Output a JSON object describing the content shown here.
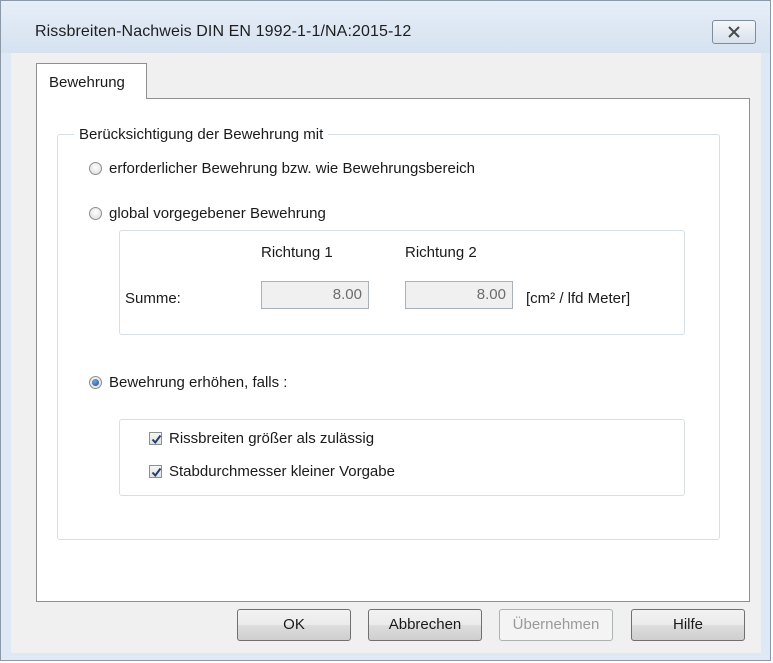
{
  "window": {
    "title": "Rissbreiten-Nachweis DIN EN 1992-1-1/NA:2015-12"
  },
  "tabs": [
    {
      "label": "Bewehrung",
      "active": true
    }
  ],
  "group": {
    "legend": "Berücksichtigung der Bewehrung mit",
    "options": [
      {
        "label": "erforderlicher Bewehrung bzw. wie Bewehrungsbereich",
        "checked": false
      },
      {
        "label": "global vorgegebener Bewehrung",
        "checked": false
      },
      {
        "label": "Bewehrung erhöhen, falls :",
        "checked": true
      }
    ],
    "global_panel": {
      "col1_header": "Richtung 1",
      "col2_header": "Richtung 2",
      "row_label": "Summe:",
      "value1": "8.00",
      "value2": "8.00",
      "unit": "[cm² / lfd Meter]"
    },
    "increase_panel": {
      "checks": [
        {
          "label": "Rissbreiten größer als zulässig",
          "checked": true
        },
        {
          "label": "Stabdurchmesser kleiner Vorgabe",
          "checked": true
        }
      ]
    }
  },
  "buttons": {
    "ok": "OK",
    "cancel": "Abbrechen",
    "apply": "Übernehmen",
    "help": "Hilfe"
  },
  "colors": {
    "title_bar": "#dfe9f5",
    "radio_dot": "#1f4f86",
    "check_mark": "#1f3f73"
  },
  "icons": {
    "close": "close-icon",
    "check": "check-icon"
  }
}
